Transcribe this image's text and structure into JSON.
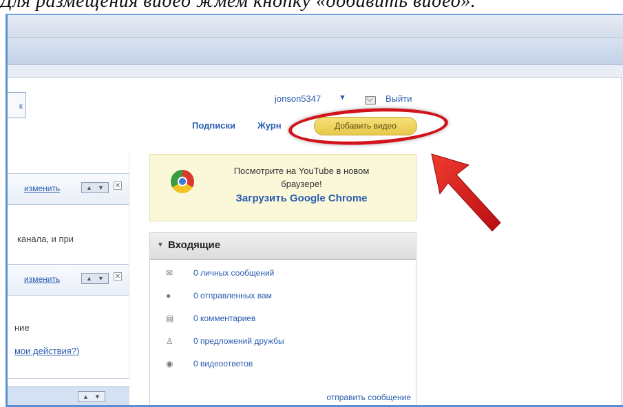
{
  "caption": "Для размещения видео жмем кнопку «добавить видео».",
  "header": {
    "search_fragment": "к",
    "username": "jonson5347",
    "user_arrow": "▼",
    "logout": "Выйти",
    "nav": {
      "subscriptions": "Подписки",
      "journal": "Журн",
      "upload": "Добавить видео"
    }
  },
  "sidebar": {
    "module1": {
      "edit": "изменить",
      "up": "▲",
      "down": "▼",
      "close": "✕",
      "text": "канала, и при"
    },
    "module2": {
      "edit": "изменить",
      "up": "▲",
      "down": "▼",
      "close": "✕",
      "text": "ние",
      "link": "мои действия?)"
    },
    "module3": {
      "up": "▲",
      "down": "▼"
    }
  },
  "promo": {
    "line1": "Посмотрите на YouTube в новом",
    "line2": "браузере!",
    "link": "Загрузить Google Chrome"
  },
  "inbox": {
    "title": "Входящие",
    "toggle": "▼",
    "items": [
      {
        "icon": "envelope-icon",
        "glyph": "✉",
        "label": "0 личных сообщений"
      },
      {
        "icon": "speech-bubble-icon",
        "glyph": "●",
        "label": "0 отправленных вам"
      },
      {
        "icon": "comment-icon",
        "glyph": "▤",
        "label": "0 комментариев"
      },
      {
        "icon": "person-icon",
        "glyph": "♙",
        "label": "0 предложений дружбы"
      },
      {
        "icon": "video-reply-icon",
        "glyph": "◉",
        "label": "0 видеоответов"
      }
    ],
    "send_message": "отправить сообщение"
  },
  "colors": {
    "accent_red": "#d0141a",
    "link_blue": "#2a5db0",
    "upload_yellow": "#e7c84a"
  }
}
